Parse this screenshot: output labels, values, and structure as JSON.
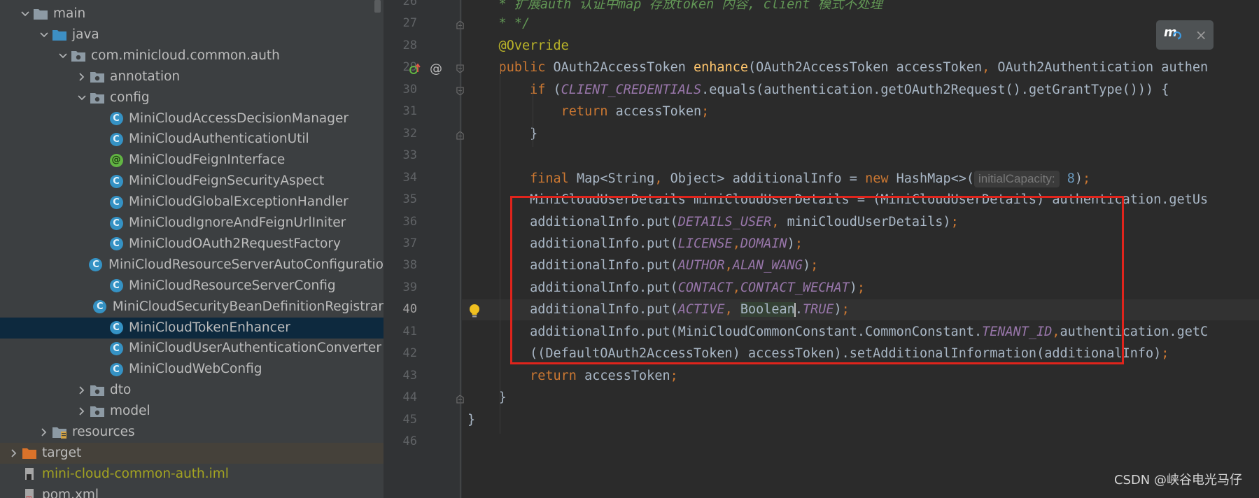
{
  "tree": {
    "items": [
      {
        "label": "main",
        "depth": 1,
        "arrow": "down",
        "icon": "folder-icon",
        "state": ""
      },
      {
        "label": "java",
        "depth": 2,
        "arrow": "down",
        "icon": "source-folder-icon",
        "state": ""
      },
      {
        "label": "com.minicloud.common.auth",
        "depth": 3,
        "arrow": "down",
        "icon": "package-icon",
        "state": ""
      },
      {
        "label": "annotation",
        "depth": 4,
        "arrow": "right",
        "icon": "package-icon",
        "state": ""
      },
      {
        "label": "config",
        "depth": 4,
        "arrow": "down",
        "icon": "package-icon",
        "state": ""
      },
      {
        "label": "MiniCloudAccessDecisionManager",
        "depth": 5,
        "arrow": "none",
        "icon": "class-icon",
        "state": ""
      },
      {
        "label": "MiniCloudAuthenticationUtil",
        "depth": 5,
        "arrow": "none",
        "icon": "class-icon",
        "state": ""
      },
      {
        "label": "MiniCloudFeignInterface",
        "depth": 5,
        "arrow": "none",
        "icon": "annotation-icon",
        "state": ""
      },
      {
        "label": "MiniCloudFeignSecurityAspect",
        "depth": 5,
        "arrow": "none",
        "icon": "class-icon",
        "state": ""
      },
      {
        "label": "MiniCloudGlobalExceptionHandler",
        "depth": 5,
        "arrow": "none",
        "icon": "class-icon",
        "state": ""
      },
      {
        "label": "MiniCloudIgnoreAndFeignUrlIniter",
        "depth": 5,
        "arrow": "none",
        "icon": "class-icon",
        "state": ""
      },
      {
        "label": "MiniCloudOAuth2RequestFactory",
        "depth": 5,
        "arrow": "none",
        "icon": "class-icon",
        "state": ""
      },
      {
        "label": "MiniCloudResourceServerAutoConfiguratio",
        "depth": 5,
        "arrow": "none",
        "icon": "class-icon",
        "state": ""
      },
      {
        "label": "MiniCloudResourceServerConfig",
        "depth": 5,
        "arrow": "none",
        "icon": "class-icon",
        "state": ""
      },
      {
        "label": "MiniCloudSecurityBeanDefinitionRegistrar",
        "depth": 5,
        "arrow": "none",
        "icon": "class-icon",
        "state": ""
      },
      {
        "label": "MiniCloudTokenEnhancer",
        "depth": 5,
        "arrow": "none",
        "icon": "class-icon",
        "state": "selected"
      },
      {
        "label": "MiniCloudUserAuthenticationConverter",
        "depth": 5,
        "arrow": "none",
        "icon": "class-icon",
        "state": ""
      },
      {
        "label": "MiniCloudWebConfig",
        "depth": 5,
        "arrow": "none",
        "icon": "class-icon",
        "state": ""
      },
      {
        "label": "dto",
        "depth": 4,
        "arrow": "right",
        "icon": "package-icon",
        "state": ""
      },
      {
        "label": "model",
        "depth": 4,
        "arrow": "right",
        "icon": "package-icon",
        "state": ""
      },
      {
        "label": "resources",
        "depth": 2,
        "arrow": "right",
        "icon": "resources-folder-icon",
        "state": ""
      },
      {
        "label": "target",
        "depth": 0,
        "arrow": "right",
        "icon": "excluded-folder-icon",
        "state": "shaded"
      },
      {
        "label": "mini-cloud-common-auth.iml",
        "depth": 0,
        "arrow": "none",
        "icon": "iml-file-icon",
        "state": "olive"
      },
      {
        "label": "pom.xml",
        "depth": 0,
        "arrow": "none",
        "icon": "maven-file-icon",
        "state": ""
      }
    ]
  },
  "editor": {
    "current_line": "40",
    "lines": [
      {
        "no": "26",
        "tokens": [
          [
            "cmt",
            "    * 扩展auth 认证中map 存放token 内容, client 模式不处理"
          ]
        ]
      },
      {
        "no": "27",
        "tokens": [
          [
            "cmt",
            "    * */"
          ]
        ]
      },
      {
        "no": "28",
        "tokens": [
          [
            "anno",
            "    @Override"
          ]
        ]
      },
      {
        "no": "29",
        "tokens": [
          [
            "kw",
            "    public "
          ],
          [
            "",
            "OAuth2AccessToken "
          ],
          [
            "fn",
            "enhance"
          ],
          [
            "",
            "(OAuth2AccessToken accessToken"
          ],
          [
            "pun",
            ", "
          ],
          [
            "",
            "OAuth2Authentication authen"
          ]
        ]
      },
      {
        "no": "30",
        "tokens": [
          [
            "kw",
            "        if "
          ],
          [
            "",
            "("
          ],
          [
            "cst",
            "CLIENT_CREDENTIALS"
          ],
          [
            "",
            ".equals(authentication.getOAuth2Request().getGrantType())) {"
          ]
        ]
      },
      {
        "no": "31",
        "tokens": [
          [
            "kw",
            "            return "
          ],
          [
            "",
            "accessToken"
          ],
          [
            "pun",
            ";"
          ]
        ]
      },
      {
        "no": "32",
        "tokens": [
          [
            "",
            "        }"
          ]
        ]
      },
      {
        "no": "33",
        "tokens": []
      },
      {
        "no": "34",
        "tokens": [
          [
            "kw",
            "        final "
          ],
          [
            "",
            "Map<String"
          ],
          [
            "pun",
            ", "
          ],
          [
            "",
            "Object> additionalInfo = "
          ],
          [
            "kw",
            "new "
          ],
          [
            "",
            "HashMap<>("
          ],
          [
            "hint",
            "initialCapacity:"
          ],
          [
            "num",
            " 8"
          ],
          [
            "",
            ")"
          ],
          [
            "pun",
            ";"
          ]
        ]
      },
      {
        "no": "35",
        "tokens": [
          [
            "",
            "        MiniCloudUserDetails miniCloudUserDetails = (MiniCloudUserDetails) authentication.getUs"
          ]
        ]
      },
      {
        "no": "36",
        "tokens": [
          [
            "",
            "        additionalInfo.put("
          ],
          [
            "cst",
            "DETAILS_USER"
          ],
          [
            "pun",
            ", "
          ],
          [
            "",
            "miniCloudUserDetails)"
          ],
          [
            "pun",
            ";"
          ]
        ]
      },
      {
        "no": "37",
        "tokens": [
          [
            "",
            "        additionalInfo.put("
          ],
          [
            "cst",
            "LICENSE"
          ],
          [
            "pun",
            ","
          ],
          [
            "cst",
            "DOMAIN"
          ],
          [
            "",
            ")"
          ],
          [
            "pun",
            ";"
          ]
        ]
      },
      {
        "no": "38",
        "tokens": [
          [
            "",
            "        additionalInfo.put("
          ],
          [
            "cst",
            "AUTHOR"
          ],
          [
            "pun",
            ","
          ],
          [
            "cst",
            "ALAN_WANG"
          ],
          [
            "",
            ")"
          ],
          [
            "pun",
            ";"
          ]
        ]
      },
      {
        "no": "39",
        "tokens": [
          [
            "",
            "        additionalInfo.put("
          ],
          [
            "cst",
            "CONTACT"
          ],
          [
            "pun",
            ","
          ],
          [
            "cst",
            "CONTACT_WECHAT"
          ],
          [
            "",
            ")"
          ],
          [
            "pun",
            ";"
          ]
        ]
      },
      {
        "no": "40",
        "tokens": [
          [
            "",
            "        additionalInfo.put("
          ],
          [
            "cst",
            "ACTIVE"
          ],
          [
            "pun",
            ", "
          ],
          [
            "hl-word",
            "Boolean"
          ],
          [
            "caret",
            ""
          ],
          [
            "",
            "."
          ],
          [
            "cst",
            "TRUE"
          ],
          [
            "",
            ")"
          ],
          [
            "pun",
            ";"
          ]
        ]
      },
      {
        "no": "41",
        "tokens": [
          [
            "",
            "        additionalInfo.put(MiniCloudCommonConstant.CommonConstant."
          ],
          [
            "cst",
            "TENANT_ID"
          ],
          [
            "pun",
            ","
          ],
          [
            "",
            "authentication.getC"
          ]
        ]
      },
      {
        "no": "42",
        "tokens": [
          [
            "",
            "        ((DefaultOAuth2AccessToken) accessToken).setAdditionalInformation(additionalInfo)"
          ],
          [
            "pun",
            ";"
          ]
        ]
      },
      {
        "no": "43",
        "tokens": [
          [
            "kw",
            "        return "
          ],
          [
            "",
            "accessToken"
          ],
          [
            "pun",
            ";"
          ]
        ]
      },
      {
        "no": "44",
        "tokens": [
          [
            "",
            "    }"
          ]
        ]
      },
      {
        "no": "45",
        "tokens": [
          [
            "",
            "}"
          ]
        ]
      },
      {
        "no": "46",
        "tokens": []
      }
    ]
  },
  "plugin_popup": {
    "icon": "plugin-sync-icon",
    "close_label": "×"
  },
  "watermark": "CSDN @峡谷电光马仔",
  "colors": {
    "highlight_box": "#e0241c",
    "selection": "#0d293e"
  }
}
